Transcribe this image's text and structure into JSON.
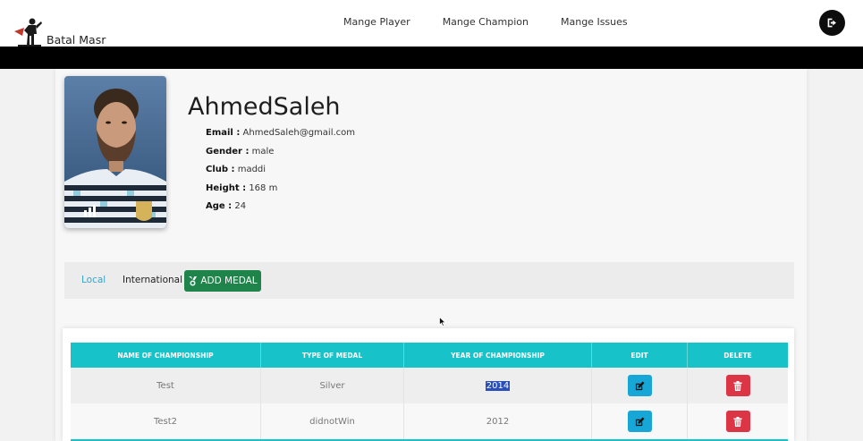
{
  "brand": {
    "name": "Batal Masr",
    "logo_icon": "superhero-icon"
  },
  "nav": {
    "links": [
      {
        "label": "Mange Player"
      },
      {
        "label": "Mange Champion"
      },
      {
        "label": "Mange Issues"
      }
    ],
    "logout_icon": "sign-out-icon"
  },
  "player": {
    "name": "AhmedSaleh",
    "fields": [
      {
        "key": "Email :",
        "value": "AhmedSaleh@gmail.com"
      },
      {
        "key": "Gender :",
        "value": "male"
      },
      {
        "key": "Club :",
        "value": "maddi"
      },
      {
        "key": "Height :",
        "value": "168 m"
      },
      {
        "key": "Age :",
        "value": "24"
      }
    ]
  },
  "tabs": {
    "local": "Local",
    "international": "International",
    "add_medal": "ADD MEDAL",
    "active_color": "#3aa4c8",
    "add_color": "#1e8449"
  },
  "table": {
    "headers": [
      "NAME OF CHAMPIONSHIP",
      "TYPE OF MEDAL",
      "YEAR OF CHAMPIONSHIP",
      "EDIT",
      "DELETE"
    ],
    "rows": [
      {
        "name": "Test",
        "medal": "Silver",
        "year": "2014"
      },
      {
        "name": "Test2",
        "medal": "didnotWin",
        "year": "2012"
      }
    ],
    "header_color": "#17c3c9",
    "edit_color": "#17a7d6",
    "delete_color": "#dc3545"
  }
}
